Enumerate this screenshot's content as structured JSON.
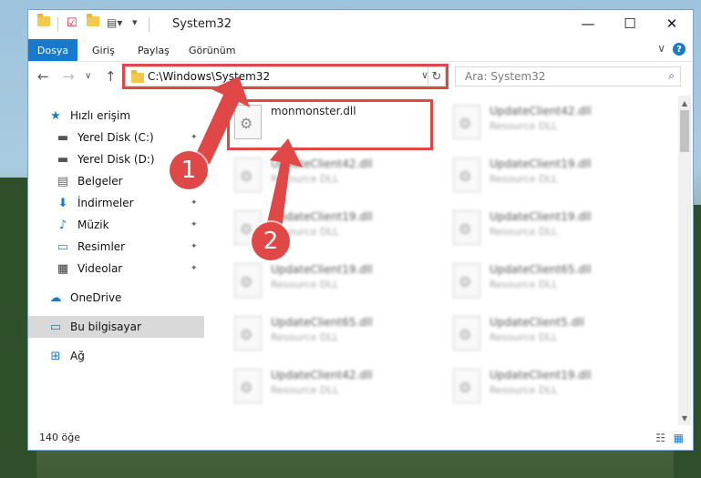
{
  "window": {
    "title": "System32",
    "controls": {
      "minimize": "—",
      "maximize": "☐",
      "close": "✕"
    }
  },
  "ribbon": {
    "tabs": [
      "Dosya",
      "Giriş",
      "Paylaş",
      "Görünüm"
    ],
    "help": "?",
    "expand": "∨"
  },
  "nav": {
    "back": "←",
    "forward": "→",
    "recent": "∨",
    "up": "↑",
    "address": "C:\\Windows\\System32",
    "address_dropdown": "∨",
    "refresh": "↻",
    "search_placeholder": "Ara: System32",
    "search_icon": "⌕"
  },
  "sidebar": {
    "items": [
      {
        "label": "Hızlı erişim",
        "icon": "star-icon",
        "glyph": "★",
        "pinned": false
      },
      {
        "label": "Yerel Disk (C:)",
        "icon": "drive-icon",
        "glyph": "▬",
        "pinned": true
      },
      {
        "label": "Yerel Disk (D:)",
        "icon": "drive-icon",
        "glyph": "▬",
        "pinned": false
      },
      {
        "label": "Belgeler",
        "icon": "documents-icon",
        "glyph": "▤",
        "pinned": true
      },
      {
        "label": "İndirmeler",
        "icon": "download-icon",
        "glyph": "⬇",
        "pinned": true
      },
      {
        "label": "Müzik",
        "icon": "music-icon",
        "glyph": "♪",
        "pinned": true
      },
      {
        "label": "Resimler",
        "icon": "pictures-icon",
        "glyph": "▭",
        "pinned": true
      },
      {
        "label": "Videolar",
        "icon": "video-icon",
        "glyph": "▦",
        "pinned": true
      },
      {
        "label": "OneDrive",
        "icon": "cloud-icon",
        "glyph": "☁",
        "pinned": false
      },
      {
        "label": "Bu bilgisayar",
        "icon": "computer-icon",
        "glyph": "▭",
        "pinned": false
      },
      {
        "label": "Ağ",
        "icon": "network-icon",
        "glyph": "⊞",
        "pinned": false
      }
    ],
    "pin_glyph": "📌"
  },
  "files": [
    {
      "name": "monmonster.dll",
      "type": "",
      "highlighted": true
    },
    {
      "name": "UpdateClient42.dll",
      "type": "Resource DLL"
    },
    {
      "name": "UpdateClient42.dll",
      "type": "Resource DLL"
    },
    {
      "name": "UpdateClient19.dll",
      "type": "Resource DLL"
    },
    {
      "name": "UpdateClient19.dll",
      "type": "Resource DLL"
    },
    {
      "name": "UpdateClient19.dll",
      "type": "Resource DLL"
    },
    {
      "name": "UpdateClient19.dll",
      "type": "Resource DLL"
    },
    {
      "name": "UpdateClient65.dll",
      "type": "Resource DLL"
    },
    {
      "name": "UpdateClient65.dll",
      "type": "Resource DLL"
    },
    {
      "name": "UpdateClient5.dll",
      "type": "Resource DLL"
    },
    {
      "name": "UpdateClient42.dll",
      "type": "Resource DLL"
    },
    {
      "name": "UpdateClient19.dll",
      "type": "Resource DLL"
    }
  ],
  "status": {
    "item_count": "140 öğe",
    "view_details": "☷",
    "view_icons": "▦"
  },
  "annotations": {
    "step1": "1",
    "step2": "2"
  },
  "colors": {
    "accent": "#1979ca",
    "highlight": "#e04848"
  }
}
